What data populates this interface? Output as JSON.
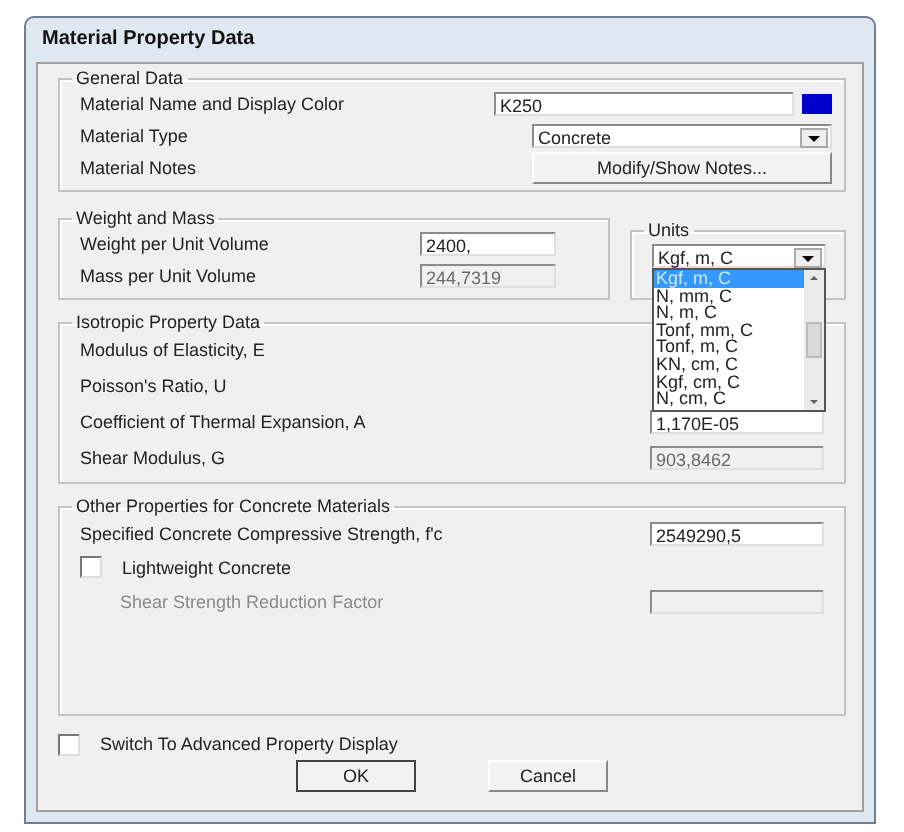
{
  "window": {
    "title": "Material Property Data"
  },
  "general": {
    "title": "General Data",
    "rows": [
      {
        "kind": "text",
        "label": "Material Name and Display Color",
        "value": "K250",
        "color": "#0000cc"
      },
      {
        "kind": "select",
        "label": "Material Type",
        "value": "Concrete"
      },
      {
        "kind": "button",
        "label": "Material Notes",
        "button": "Modify/Show Notes..."
      }
    ]
  },
  "weight": {
    "title": "Weight and Mass",
    "rows": [
      {
        "label": "Weight per Unit Volume",
        "value": "2400,",
        "disabled": false
      },
      {
        "label": "Mass per Unit Volume",
        "value": "244,7319",
        "disabled": true
      }
    ]
  },
  "units": {
    "title": "Units",
    "value": "Kgf, m, C",
    "options": [
      {
        "label": "Kgf, m, C",
        "selected": true
      },
      {
        "label": "N, mm, C",
        "selected": false
      },
      {
        "label": "N, m, C",
        "selected": false
      },
      {
        "label": "Tonf, mm, C",
        "selected": false
      },
      {
        "label": "Tonf, m, C",
        "selected": false
      },
      {
        "label": "KN, cm, C",
        "selected": false
      },
      {
        "label": "Kgf, cm, C",
        "selected": false
      },
      {
        "label": "N, cm, C",
        "selected": false
      }
    ]
  },
  "isotropic": {
    "title": "Isotropic Property Data",
    "rows": [
      {
        "label": "Modulus of Elasticity,  E"
      },
      {
        "label": "Poisson's Ratio,  U"
      },
      {
        "label": "Coefficient of Thermal Expansion,  A",
        "value": "1,170E-05",
        "disabled": false
      },
      {
        "label": "Shear Modulus,  G",
        "value": "903,8462",
        "disabled": true
      }
    ]
  },
  "concrete": {
    "title": "Other Properties for Concrete Materials",
    "strength": {
      "label": "Specified Concrete Compressive Strength, f'c",
      "value": "2549290,5"
    },
    "lightweight": {
      "label": "Lightweight Concrete",
      "checked": false
    },
    "reduction": {
      "label": "Shear Strength Reduction Factor",
      "disabled": true
    }
  },
  "advanced": {
    "label": "Switch To Advanced Property Display",
    "checked": false
  },
  "buttons": [
    {
      "label": "OK",
      "default": true
    },
    {
      "label": "Cancel",
      "default": false
    }
  ]
}
